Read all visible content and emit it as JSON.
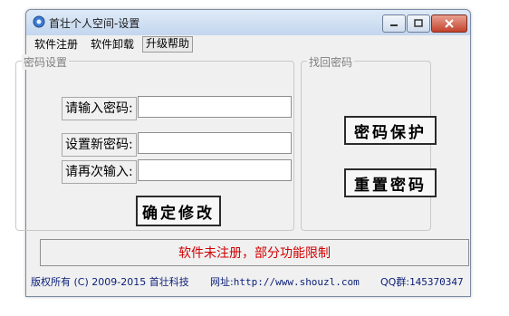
{
  "window": {
    "title": "首壮个人空间-设置"
  },
  "menu": {
    "items": [
      "软件注册",
      "软件卸载",
      "升级帮助"
    ]
  },
  "password_group": {
    "legend": "密码设置",
    "current_label": "请输入密码:",
    "new_label": "设置新密码:",
    "repeat_label": "请再次输入:",
    "current_value": "",
    "new_value": "",
    "repeat_value": "",
    "confirm_button": "确定修改"
  },
  "recover_group": {
    "legend": "找回密码",
    "protect_button": "密码保护",
    "reset_button": "重置密码"
  },
  "status": {
    "text": "软件未注册，部分功能限制"
  },
  "footer": {
    "copyright": "版权所有 (C) 2009-2015 首壮科技",
    "url_label": "网址:",
    "url": "http://www.shouzl.com",
    "qq_label": "QQ群:",
    "qq": "145370347"
  },
  "colors": {
    "status_text": "#d00000",
    "footer_text": "#0a1e78"
  }
}
